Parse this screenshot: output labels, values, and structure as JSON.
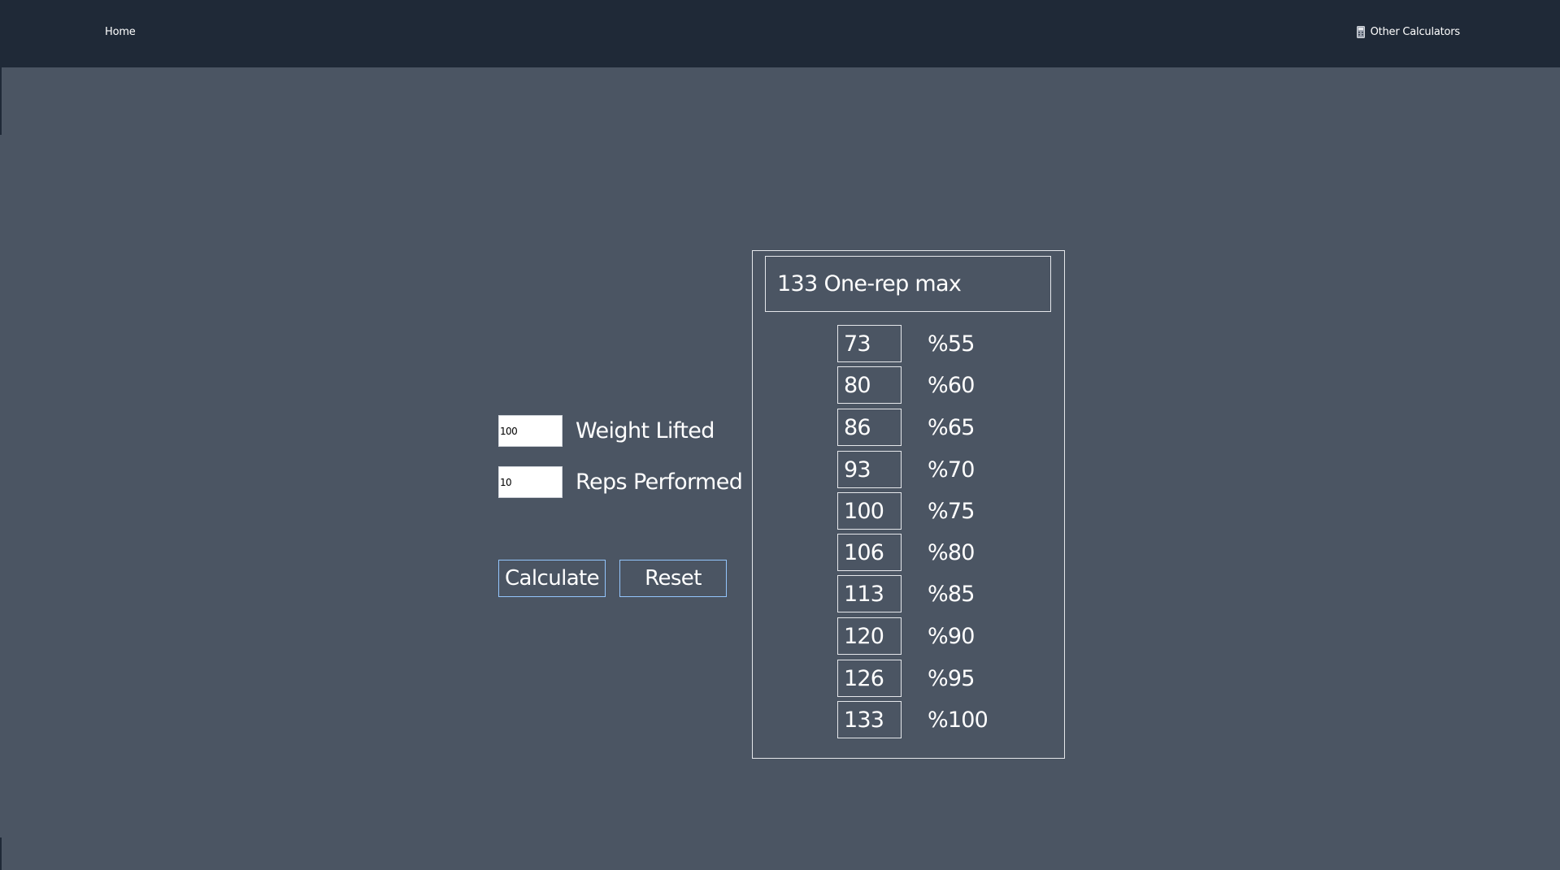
{
  "nav": {
    "home_label": "Home",
    "other_label": "Other Calculators",
    "other_icon": "calculator-icon"
  },
  "form": {
    "weight": {
      "value": "100",
      "label": "Weight Lifted"
    },
    "reps": {
      "value": "10",
      "label": "Reps Performed"
    },
    "calculate_label": "Calculate",
    "reset_label": "Reset"
  },
  "result": {
    "one_rep_max_value": "133",
    "one_rep_max_label": "One-rep max",
    "percentages": [
      {
        "value": "73",
        "label": "%55"
      },
      {
        "value": "80",
        "label": "%60"
      },
      {
        "value": "86",
        "label": "%65"
      },
      {
        "value": "93",
        "label": "%70"
      },
      {
        "value": "100",
        "label": "%75"
      },
      {
        "value": "106",
        "label": "%80"
      },
      {
        "value": "113",
        "label": "%85"
      },
      {
        "value": "120",
        "label": "%90"
      },
      {
        "value": "126",
        "label": "%95"
      },
      {
        "value": "133",
        "label": "%100"
      }
    ]
  },
  "colors": {
    "navbar": "#1f2937",
    "background": "#4b5563",
    "button_border": "#93c5fd"
  }
}
